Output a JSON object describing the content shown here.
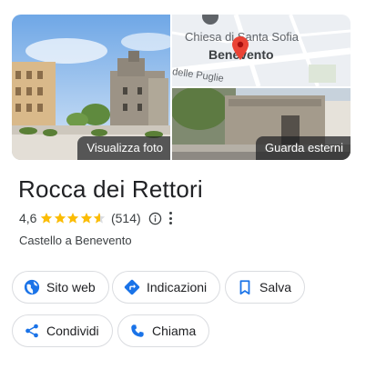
{
  "gallery": {
    "photos_label": "Visualizza foto",
    "street_label": "Guarda esterni",
    "map": {
      "poi_label": "Chiesa di Santa Sofia",
      "city_label": "Benevento",
      "street_label": "delle Puglie"
    }
  },
  "place": {
    "name": "Rocca dei Rettori",
    "rating": "4,6",
    "rating_value": 4.6,
    "stars_max": 5,
    "review_count": "(514)",
    "category": "Castello a Benevento"
  },
  "actions": {
    "website": "Sito web",
    "directions": "Indicazioni",
    "save": "Salva",
    "share": "Condividi",
    "call": "Chiama"
  },
  "colors": {
    "accent_blue": "#1a73e8",
    "star_yellow": "#fbbc04",
    "pin_red": "#ea4335"
  },
  "icons": [
    "globe-icon",
    "directions-icon",
    "bookmark-icon",
    "share-icon",
    "phone-icon",
    "info-icon",
    "more-vert-icon",
    "map-pin-icon"
  ]
}
